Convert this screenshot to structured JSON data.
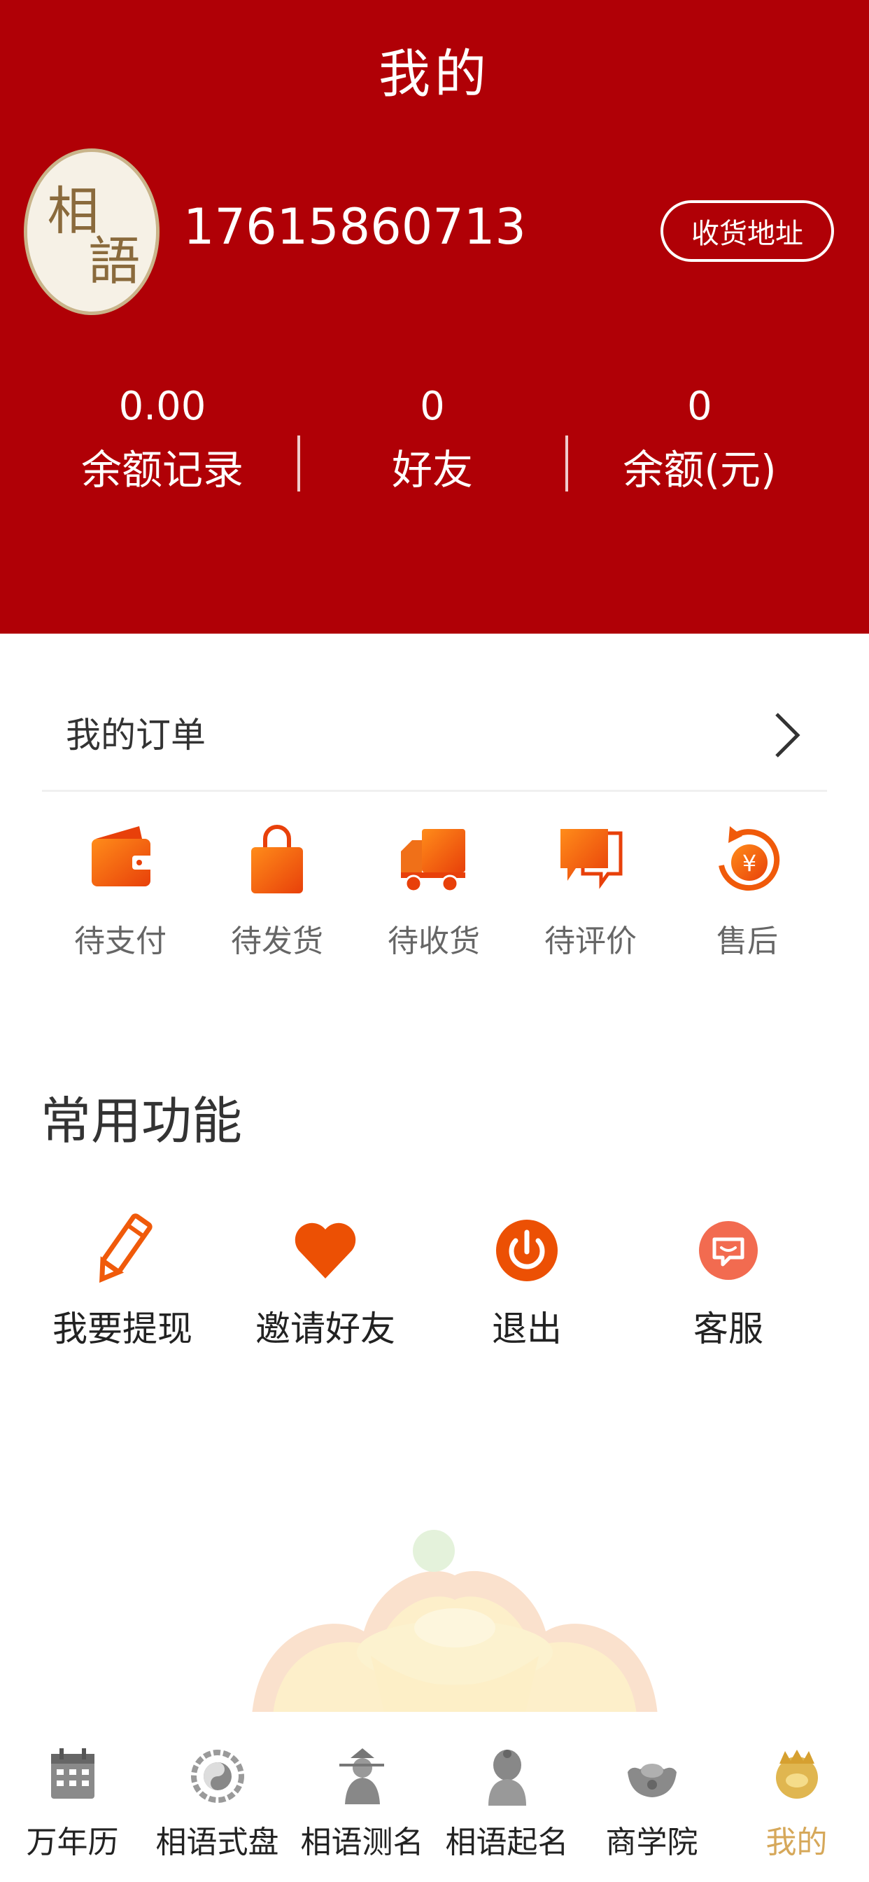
{
  "header": {
    "title": "我的",
    "phone": "17615860713",
    "address_button": "收货地址",
    "background_color": "#b00006"
  },
  "stats": [
    {
      "value": "0.00",
      "label": "余额记录"
    },
    {
      "value": "0",
      "label": "好友"
    },
    {
      "value": "0",
      "label": "余额(元)"
    }
  ],
  "orders": {
    "title": "我的订单",
    "items": [
      {
        "label": "待支付",
        "icon": "wallet-icon"
      },
      {
        "label": "待发货",
        "icon": "shopping-bag-icon"
      },
      {
        "label": "待收货",
        "icon": "truck-icon"
      },
      {
        "label": "待评价",
        "icon": "comment-icon"
      },
      {
        "label": "售后",
        "icon": "yen-refund-icon"
      }
    ]
  },
  "functions": {
    "title": "常用功能",
    "items": [
      {
        "label": "我要提现",
        "icon": "pencil-icon"
      },
      {
        "label": "邀请好友",
        "icon": "heart-icon"
      },
      {
        "label": "退出",
        "icon": "power-icon"
      },
      {
        "label": "客服",
        "icon": "chat-icon"
      }
    ]
  },
  "tabbar": {
    "items": [
      {
        "label": "万年历",
        "icon": "calendar-icon"
      },
      {
        "label": "相语式盘",
        "icon": "bagua-icon"
      },
      {
        "label": "相语测名",
        "icon": "figure-icon"
      },
      {
        "label": "相语起名",
        "icon": "buddha-icon"
      },
      {
        "label": "商学院",
        "icon": "ingot-icon"
      },
      {
        "label": "我的",
        "icon": "mascot-icon"
      }
    ],
    "active_index": 5,
    "active_color": "#d6a85a"
  },
  "colors": {
    "accent": "#b00006",
    "icon_orange": "#f05a0a"
  }
}
